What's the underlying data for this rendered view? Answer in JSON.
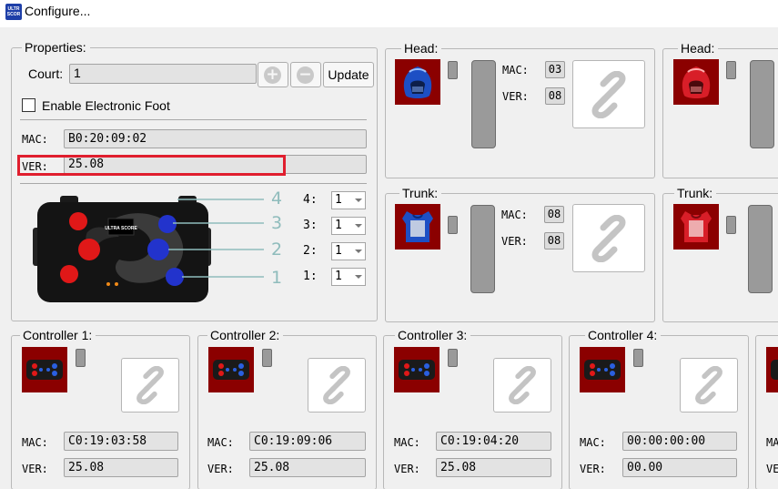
{
  "window": {
    "title": "Configure...",
    "icon_text": "ULTR SCOR"
  },
  "properties": {
    "group_label": "Properties:",
    "court_label": "Court:",
    "court_value": "1",
    "update_label": "Update",
    "enable_foot_label": "Enable Electronic Foot",
    "enable_foot_checked": false,
    "mac_label": "MAC:",
    "mac_value": "B0:20:09:02",
    "ver_label": "VER:",
    "ver_value": "25.08",
    "device_brand": "ULTRA SCORE",
    "ports": [
      {
        "callout": "4",
        "label": "4:",
        "value": "1"
      },
      {
        "callout": "3",
        "label": "3:",
        "value": "1"
      },
      {
        "callout": "2",
        "label": "2:",
        "value": "1"
      },
      {
        "callout": "1",
        "label": "1:",
        "value": "1"
      }
    ]
  },
  "sensors": [
    {
      "head": {
        "label": "Head:",
        "mac_label": "MAC:",
        "mac_value": "03",
        "ver_label": "VER:",
        "ver_value": "08",
        "color": "#1d4fc4"
      },
      "trunk": {
        "label": "Trunk:",
        "mac_label": "MAC:",
        "mac_value": "08",
        "ver_label": "VER:",
        "ver_value": "08",
        "color": "#1d4fc4"
      }
    },
    {
      "head": {
        "label": "Head:",
        "color": "#d81e28"
      },
      "trunk": {
        "label": "Trunk:",
        "color": "#d81e28"
      }
    }
  ],
  "controllers": [
    {
      "label": "Controller 1:",
      "mac_label": "MAC:",
      "mac_value": "C0:19:03:58",
      "ver_label": "VER:",
      "ver_value": "25.08"
    },
    {
      "label": "Controller 2:",
      "mac_label": "MAC:",
      "mac_value": "C0:19:09:06",
      "ver_label": "VER:",
      "ver_value": "25.08"
    },
    {
      "label": "Controller 3:",
      "mac_label": "MAC:",
      "mac_value": "C0:19:04:20",
      "ver_label": "VER:",
      "ver_value": "25.08"
    },
    {
      "label": "Controller 4:",
      "mac_label": "MAC:",
      "mac_value": "00:00:00:00",
      "ver_label": "VER:",
      "ver_value": "00.00"
    },
    {
      "mac_label": "MAC",
      "ver_label": "VER"
    }
  ],
  "icons": {
    "link": "link-icon",
    "plus": "plus-icon",
    "minus": "minus-icon"
  },
  "colors": {
    "highlight": "#e01e2e",
    "tile_bg": "#8b0000",
    "callout": "#8fbcbc"
  }
}
